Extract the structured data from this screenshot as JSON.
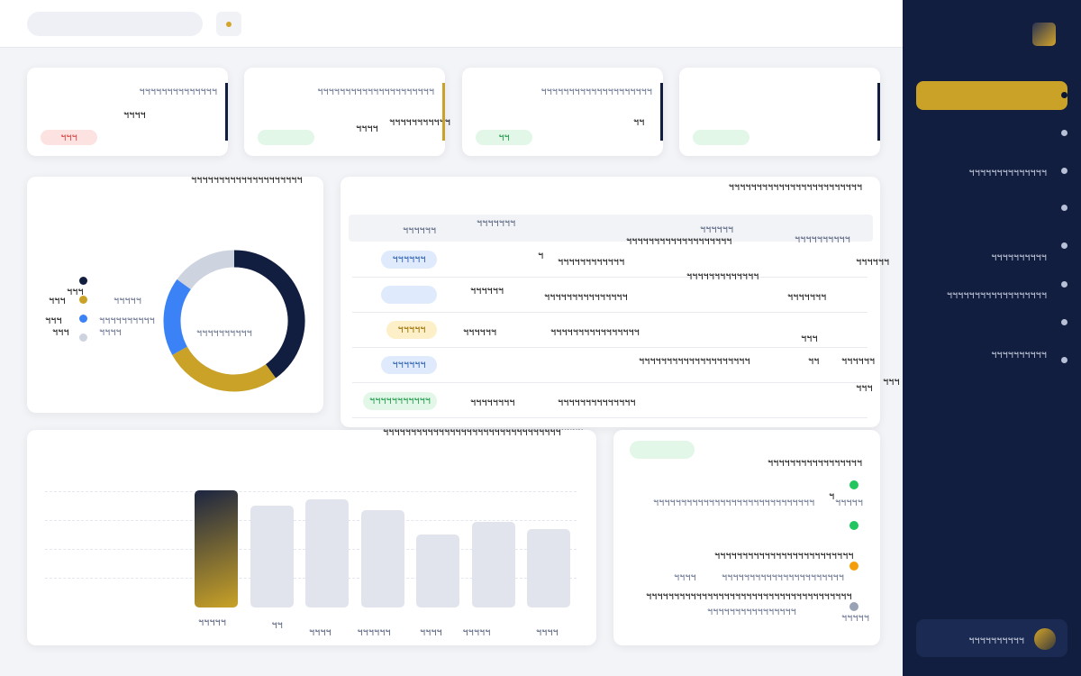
{
  "header": {
    "search_placeholder": "",
    "accent_color": "#d4a52a"
  },
  "sidebar": {
    "items": [
      {
        "label": ""
      },
      {
        "label": ""
      },
      {
        "label": "ฯฯฯฯฯฯฯฯฯฯฯฯฯฯ"
      },
      {
        "label": ""
      },
      {
        "label": "ฯฯฯฯฯฯฯฯฯฯ"
      },
      {
        "label": "ฯฯฯฯฯฯฯฯฯฯฯฯฯฯฯฯฯฯ"
      },
      {
        "label": ""
      },
      {
        "label": "ฯฯฯฯฯฯฯฯฯฯ"
      }
    ],
    "profile_name": "ฯฯฯฯฯฯฯฯฯฯ",
    "colors": {
      "bg": "#121e40",
      "active": "#c9a227"
    }
  },
  "kpis": [
    {
      "label": "ฯฯฯฯฯฯฯฯฯฯฯฯฯฯ",
      "value": "ฯฯฯฯ",
      "badge": "ฯฯฯ",
      "badge_color": "#fde2e2",
      "badge_text_color": "#d64545",
      "bar_color": "#121e40"
    },
    {
      "label": "ฯฯฯฯฯฯฯฯฯฯฯฯฯฯฯฯฯฯฯฯฯ",
      "value": "ฯฯฯฯ",
      "value2": "ฯฯฯฯฯฯฯฯฯฯฯ",
      "badge": "",
      "badge_color": "#e2f7e8",
      "bar_color": "#c9a227"
    },
    {
      "label": "ฯฯฯฯฯฯฯฯฯฯฯฯฯฯฯฯฯฯฯฯ",
      "value": "ฯฯ",
      "badge": "ฯฯ",
      "badge_color": "#e2f7e8",
      "badge_text_color": "#1f9a4a",
      "bar_color": "#121e40"
    },
    {
      "label": "",
      "value": "",
      "badge": "",
      "badge_color": "#e2f7e8",
      "bar_color": "#121e40"
    }
  ],
  "donut": {
    "title": "ฯฯฯฯฯฯฯฯฯฯฯฯฯฯฯฯฯฯฯฯ",
    "center_label": "ฯฯฯฯฯฯฯฯฯฯ",
    "legend": [
      {
        "label": "ฯฯฯ",
        "value": "",
        "color": "#121e40"
      },
      {
        "label": "ฯฯฯ",
        "value": "ฯฯฯฯฯ",
        "color": "#c9a227"
      },
      {
        "label": "ฯฯฯ",
        "value": "ฯฯฯฯฯฯฯฯฯฯ",
        "color": "#3b82f6"
      },
      {
        "label": "ฯฯฯ",
        "value": "ฯฯฯฯ",
        "color": "#cdd3df"
      }
    ]
  },
  "chart_data": [
    {
      "type": "pie",
      "categories": [
        "",
        "",
        "",
        ""
      ],
      "values": [
        40,
        27,
        18,
        15
      ],
      "colors": [
        "#121e40",
        "#c9a227",
        "#3b82f6",
        "#cdd3df"
      ],
      "title": ""
    },
    {
      "type": "bar",
      "categories": [
        "ฯฯฯฯฯ",
        "ฯฯ",
        "ฯฯฯฯ",
        "ฯฯฯฯฯฯ",
        "ฯฯฯฯ",
        "ฯฯฯฯฯ",
        "ฯฯฯฯ"
      ],
      "values": [
        100,
        87,
        92,
        83,
        62,
        73,
        67
      ],
      "highlight_index": 0,
      "title": "ฯฯฯฯฯฯฯฯฯฯฯฯฯฯฯฯฯฯฯฯฯฯฯฯฯฯฯฯฯฯฯฯ",
      "xlabel": "",
      "ylabel": "",
      "ylim": [
        0,
        100
      ],
      "grid": true
    }
  ],
  "table": {
    "title": "ฯฯฯฯฯฯฯฯฯฯฯฯฯฯฯฯฯฯฯฯฯฯฯฯ",
    "headers": [
      "ฯฯฯฯฯฯ",
      "ฯฯฯฯฯฯฯ",
      "ฯฯฯฯฯฯ",
      "ฯฯฯฯฯฯฯฯฯฯ"
    ],
    "extra_header": "ฯฯฯฯฯฯฯฯฯฯฯฯฯฯฯฯฯฯฯ",
    "rows": [
      {
        "status": "ฯฯฯฯฯฯ",
        "status_bg": "#dfeafc",
        "status_color": "#2b5fb0",
        "c1": "ฯ",
        "c2": "ฯฯฯฯฯฯฯฯฯฯฯฯ",
        "c3": "ฯฯฯฯฯฯฯฯฯฯฯฯฯ",
        "c4": "ฯฯฯฯฯฯ",
        "c5": ""
      },
      {
        "status": "",
        "status_bg": "#dfeafc",
        "status_color": "#2b5fb0",
        "c1": "ฯฯฯฯฯฯ",
        "c2": "ฯฯฯฯฯฯฯฯฯฯฯฯฯฯฯ",
        "c3": "",
        "c4": "ฯฯฯฯฯฯฯ",
        "c5": ""
      },
      {
        "status": "ฯฯฯฯฯ",
        "status_bg": "#fdf0c8",
        "status_color": "#9a6c00",
        "c1": "ฯฯฯฯฯฯ",
        "c2": "ฯฯฯฯฯฯฯฯฯฯฯฯฯฯฯฯ",
        "c3": "",
        "c4": "ฯฯฯ",
        "c5": ""
      },
      {
        "status": "ฯฯฯฯฯฯ",
        "status_bg": "#dfeafc",
        "status_color": "#2b5fb0",
        "c1": "",
        "c2": "ฯฯฯฯฯฯฯฯฯฯฯฯฯฯฯฯฯฯฯฯ",
        "c3": "ฯฯ",
        "c4": "ฯฯฯฯฯฯ",
        "c5": "ฯฯฯ"
      },
      {
        "status": "ฯฯฯฯฯฯฯฯฯฯฯ",
        "status_bg": "#e2f7e8",
        "status_color": "#1f9a4a",
        "c1": "ฯฯฯฯฯฯฯฯ",
        "c2": "ฯฯฯฯฯฯฯฯฯฯฯฯฯฯ",
        "c3": "",
        "c4": "ฯฯฯ",
        "c5": ""
      }
    ],
    "footer": "ฯฯฯฯฯฯฯฯฯฯฯฯฯฯฯฯฯฯฯฯฯฯฯฯฯฯฯฯฯฯฯฯฯฯฯฯ"
  },
  "activity": {
    "badge": "",
    "title": "ฯฯฯฯฯฯฯฯฯฯฯฯฯฯฯฯฯ",
    "items": [
      {
        "text": "ฯฯฯฯฯฯฯฯฯฯฯฯฯฯฯฯฯฯฯฯฯฯฯฯฯฯฯฯฯ",
        "meta": "ฯฯฯฯฯ",
        "extra": "ฯ",
        "color": "#22c55e"
      },
      {
        "text": "",
        "meta": "",
        "extra": "",
        "color": "#22c55e"
      },
      {
        "text": "ฯฯฯฯฯฯฯฯฯฯฯฯฯฯฯฯฯฯฯฯฯฯฯฯฯ",
        "meta": "ฯฯฯฯ",
        "extra": "ฯฯฯฯฯฯฯฯฯฯฯฯฯฯฯฯฯฯฯฯฯฯ",
        "color": "#f59e0b"
      },
      {
        "text": "ฯฯฯฯฯฯฯฯฯฯฯฯฯฯฯฯฯฯฯฯฯฯฯฯฯฯฯฯฯฯฯฯฯฯฯฯฯ",
        "meta": "ฯฯฯฯฯฯฯฯฯฯฯฯฯฯฯฯ",
        "extra": "ฯฯฯฯฯ",
        "color": "#9aa3b5"
      }
    ]
  }
}
